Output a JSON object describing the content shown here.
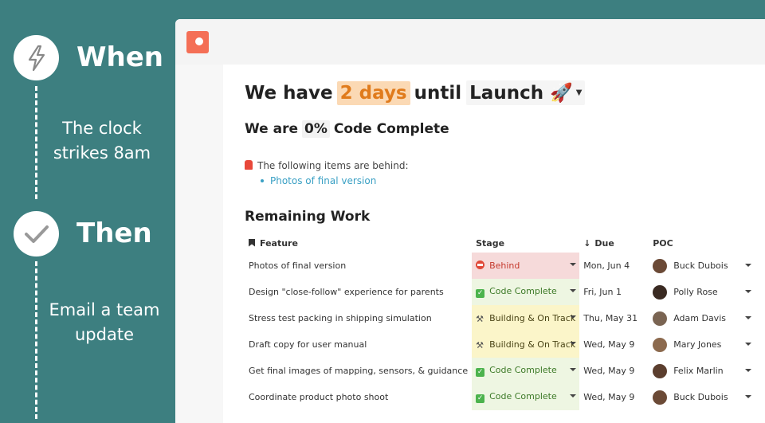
{
  "automation": {
    "when": {
      "title": "When",
      "description": "The clock strikes 8am",
      "icon": "lightning-icon"
    },
    "then": {
      "title": "Then",
      "description": "Email a team update",
      "icon": "checkmark-icon"
    }
  },
  "doc": {
    "headline": {
      "prefix": "We have",
      "days": "2 days",
      "middle": "until",
      "milestone": "Launch 🚀"
    },
    "status": {
      "prefix": "We are",
      "percent": "0%",
      "suffix": "Code Complete"
    },
    "behind": {
      "heading": "The following items are behind:",
      "items": [
        "Photos of final version"
      ]
    },
    "section_title": "Remaining Work",
    "table": {
      "headers": {
        "feature": "Feature",
        "stage": "Stage",
        "due": "Due",
        "poc": "POC"
      },
      "rows": [
        {
          "feature": "Photos of final version",
          "stage": "Behind",
          "due": "Mon, Jun 4",
          "poc": "Buck Dubois"
        },
        {
          "feature": "Design \"close-follow\" experience for parents",
          "stage": "Code Complete",
          "due": "Fri, Jun 1",
          "poc": "Polly Rose"
        },
        {
          "feature": "Stress test packing in shipping simulation",
          "stage": "Building & On Track",
          "due": "Thu, May 31",
          "poc": "Adam Davis"
        },
        {
          "feature": "Draft copy for user manual",
          "stage": "Building & On Track",
          "due": "Wed, May 9",
          "poc": "Mary Jones"
        },
        {
          "feature": "Get final images of mapping, sensors, & guidance",
          "stage": "Code Complete",
          "due": "Wed, May 9",
          "poc": "Felix Marlin"
        },
        {
          "feature": "Coordinate product photo shoot",
          "stage": "Code Complete",
          "due": "Wed, May 9",
          "poc": "Buck Dubois"
        }
      ]
    }
  },
  "colors": {
    "panel": "#3d7f80",
    "accent": "#e07b1c",
    "link": "#3aa0c4",
    "logo": "#f46f56"
  }
}
